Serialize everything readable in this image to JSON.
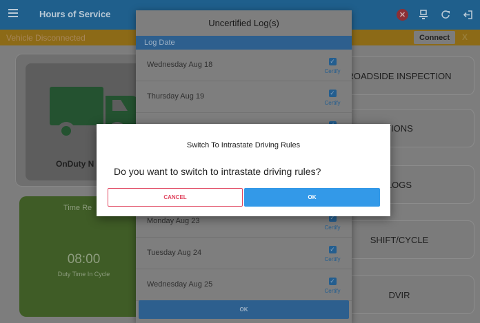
{
  "appbar": {
    "title": "Hours of Service",
    "icons": [
      "menu-icon",
      "close-circle-icon",
      "device-icon",
      "refresh-icon",
      "logout-icon"
    ]
  },
  "status": {
    "text": "Vehicle Disconnected",
    "connect_label": "Connect",
    "close_label": "X"
  },
  "duty": {
    "label": "OnDuty N"
  },
  "time": {
    "label": "Time Re",
    "value": "08:00",
    "sub": "Duty Time In Cycle"
  },
  "menu": {
    "roadside": "ROADSIDE INSPECTION",
    "options": "TIONS",
    "logs": "LOGS",
    "shift": "SHIFT/CYCLE",
    "dvir": "DVIR"
  },
  "logs_dialog": {
    "title": "Uncertified Log(s)",
    "header": "Log Date",
    "certify_label": "Certify",
    "rows": [
      "Wednesday Aug 18",
      "Thursday Aug 19",
      "Monday Aug 23",
      "Tuesday Aug 24",
      "Wednesday Aug 25"
    ],
    "ok_label": "OK"
  },
  "switch_dialog": {
    "title": "Switch To Intrastate Driving Rules",
    "message": "Do you want to switch to intrastate driving rules?",
    "cancel_label": "CANCEL",
    "ok_label": "OK"
  },
  "colors": {
    "primary": "#3399e8",
    "danger": "#e0455f",
    "appbar": "#1f5f8c",
    "status": "#8c6a17"
  }
}
